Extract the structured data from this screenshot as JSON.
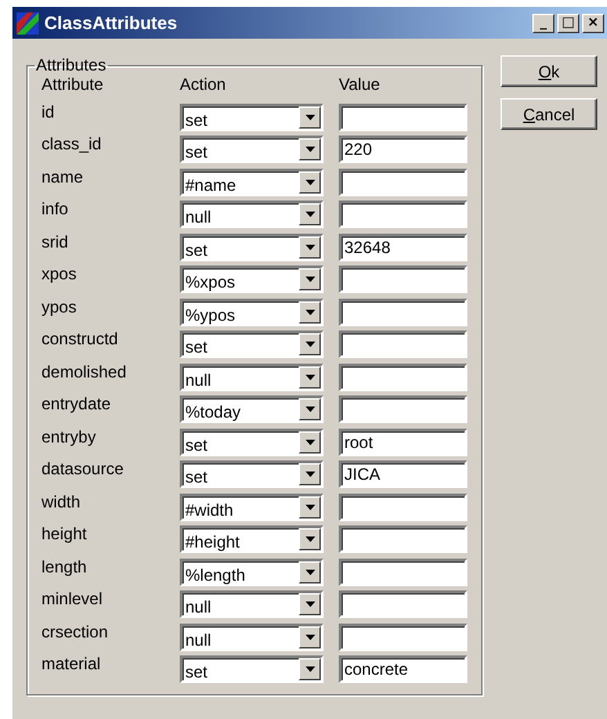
{
  "window": {
    "title": "ClassAttributes",
    "controls": [
      "_",
      "□",
      "×"
    ]
  },
  "group": {
    "title": "Attributes",
    "headers": [
      "Attribute",
      "Action",
      "Value"
    ],
    "rows": [
      {
        "attribute": "id",
        "action": "set",
        "value": ""
      },
      {
        "attribute": "class_id",
        "action": "set",
        "value": "220"
      },
      {
        "attribute": "name",
        "action": "#name",
        "value": ""
      },
      {
        "attribute": "info",
        "action": "null",
        "value": ""
      },
      {
        "attribute": "srid",
        "action": "set",
        "value": "32648"
      },
      {
        "attribute": "xpos",
        "action": "%xpos",
        "value": ""
      },
      {
        "attribute": "ypos",
        "action": "%ypos",
        "value": ""
      },
      {
        "attribute": "constructd",
        "action": "set",
        "value": ""
      },
      {
        "attribute": "demolished",
        "action": "null",
        "value": ""
      },
      {
        "attribute": "entrydate",
        "action": "%today",
        "value": ""
      },
      {
        "attribute": "entryby",
        "action": "set",
        "value": "root"
      },
      {
        "attribute": "datasource",
        "action": "set",
        "value": "JICA"
      },
      {
        "attribute": "width",
        "action": "#width",
        "value": ""
      },
      {
        "attribute": "height",
        "action": "#height",
        "value": ""
      },
      {
        "attribute": "length",
        "action": "%length",
        "value": ""
      },
      {
        "attribute": "minlevel",
        "action": "null",
        "value": ""
      },
      {
        "attribute": "crsection",
        "action": "null",
        "value": ""
      },
      {
        "attribute": "material",
        "action": "set",
        "value": "concrete"
      }
    ]
  },
  "buttons": [
    {
      "label": "Ok"
    },
    {
      "label": "Cancel"
    }
  ]
}
